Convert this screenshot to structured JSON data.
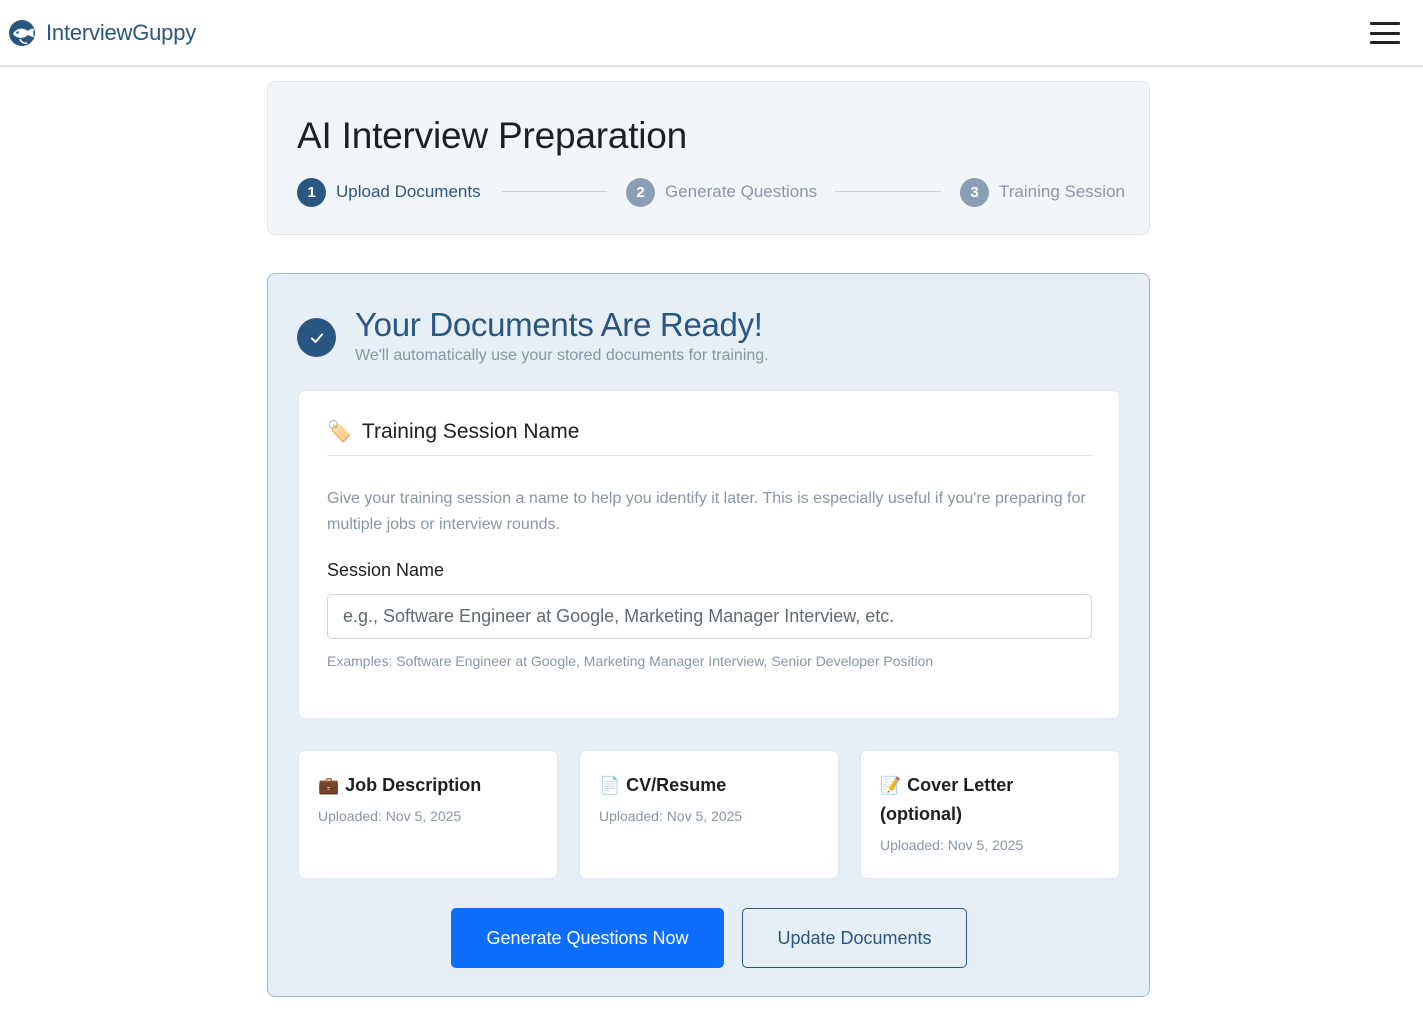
{
  "header": {
    "brand_name": "InterviewGuppy",
    "logo_icon": "fish-logo-icon",
    "menu_icon": "hamburger-menu-icon"
  },
  "steps_card": {
    "title": "AI Interview Preparation",
    "steps": [
      {
        "number": "1",
        "label": "Upload Documents",
        "state": "active"
      },
      {
        "number": "2",
        "label": "Generate Questions",
        "state": "inactive"
      },
      {
        "number": "3",
        "label": "Training Session",
        "state": "inactive"
      }
    ]
  },
  "ready": {
    "icon": "checkmark-icon",
    "title": "Your Documents Are Ready!",
    "subtitle": "We'll automatically use your stored documents for training."
  },
  "session": {
    "icon": "label-tag-icon",
    "title": "Training Session Name",
    "description": "Give your training session a name to help you identify it later. This is especially useful if you're preparing for multiple jobs or interview rounds.",
    "field_label": "Session Name",
    "input_value": "",
    "input_placeholder": "e.g., Software Engineer at Google, Marketing Manager Interview, etc.",
    "examples": "Examples: Software Engineer at Google, Marketing Manager Interview, Senior Developer Position"
  },
  "documents": [
    {
      "icon": "briefcase-icon",
      "title": "Job Description",
      "uploaded": "Uploaded: Nov 5, 2025"
    },
    {
      "icon": "document-icon",
      "title": "CV/Resume",
      "uploaded": "Uploaded: Nov 5, 2025"
    },
    {
      "icon": "memo-pencil-icon",
      "title": "Cover Letter (optional)",
      "uploaded": "Uploaded: Nov 5, 2025"
    }
  ],
  "actions": {
    "primary_label": "Generate Questions Now",
    "secondary_label": "Update Documents"
  },
  "colors": {
    "brand": "#2a5682",
    "primary_button": "#0d6efd",
    "muted_text": "#8796a8",
    "ready_card_bg": "#e6eef6"
  }
}
